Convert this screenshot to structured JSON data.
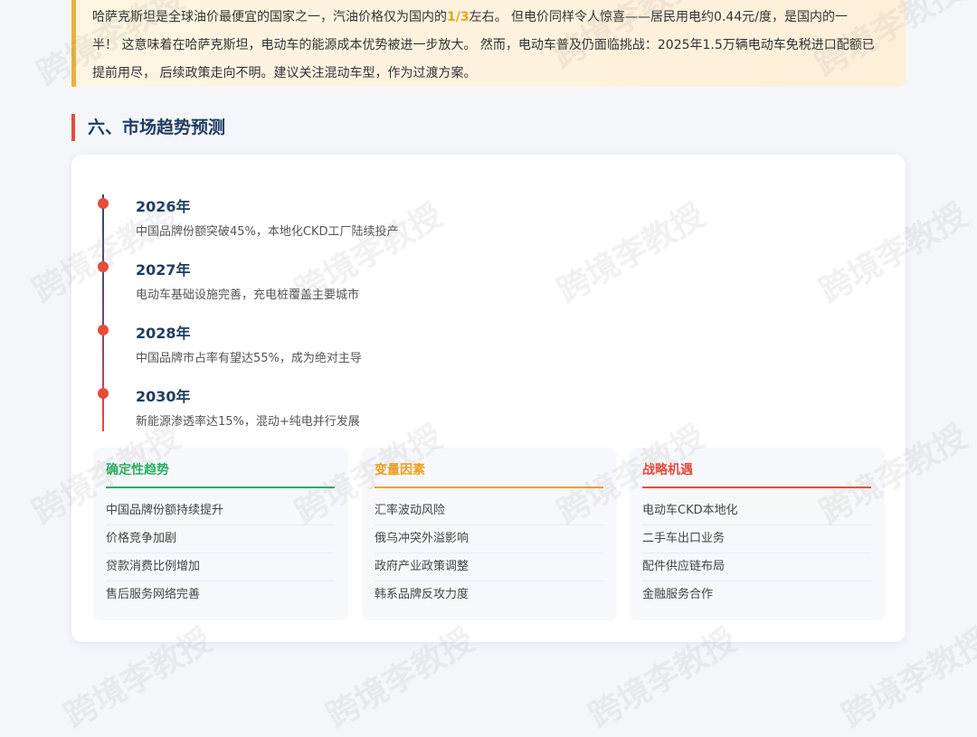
{
  "callout": {
    "line1_pre": "哈萨克斯坦是全球油价最便宜的国家之一，汽油价格仅为国内的",
    "line1_highlight": "1/3",
    "line1_post": "左右。 但电价同样令人惊喜——居民用电约0.44元/度，是国内的一",
    "line2": "半！ 这意味着在哈萨克斯坦，电动车的能源成本优势被进一步放大。 然而，电动车普及仍面临挑战：2025年1.5万辆电动车免税进口配额已",
    "line3": "提前用尽， 后续政策走向不明。建议关注混动车型，作为过渡方案。",
    "accent_color": "#e8b33a"
  },
  "section": {
    "title": "六、市场趋势预测",
    "accent_color": "#e74c3c"
  },
  "timeline": [
    {
      "year": "2026年",
      "desc": "中国品牌份额突破45%，本地化CKD工厂陆续投产"
    },
    {
      "year": "2027年",
      "desc": "电动车基础设施完善，充电桩覆盖主要城市"
    },
    {
      "year": "2028年",
      "desc": "中国品牌市占率有望达55%，成为绝对主导"
    },
    {
      "year": "2030年",
      "desc": "新能源渗透率达15%，混动+纯电并行发展"
    }
  ],
  "columns": [
    {
      "title": "确定性趋势",
      "color": "#27ae60",
      "items": [
        "中国品牌份额持续提升",
        "价格竞争加剧",
        "贷款消费比例增加",
        "售后服务网络完善"
      ]
    },
    {
      "title": "变量因素",
      "color": "#f0a020",
      "items": [
        "汇率波动风险",
        "俄乌冲突外溢影响",
        "政府产业政策调整",
        "韩系品牌反攻力度"
      ]
    },
    {
      "title": "战略机遇",
      "color": "#e74c3c",
      "items": [
        "电动车CKD本地化",
        "二手车出口业务",
        "配件供应链布局",
        "金融服务合作"
      ]
    }
  ],
  "watermark": "跨境李教授"
}
